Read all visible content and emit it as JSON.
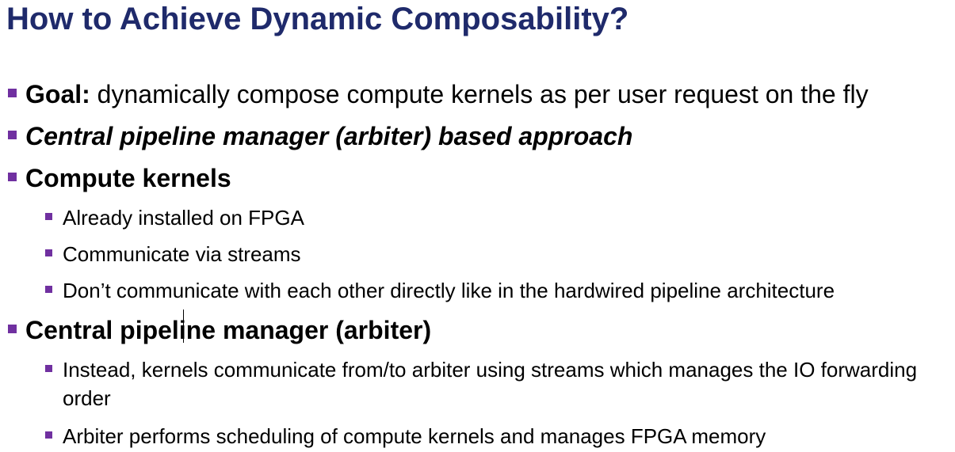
{
  "slide": {
    "title": "How to Achieve Dynamic Composability?",
    "bullets": [
      {
        "lead": "Goal:",
        "rest": " dynamically compose compute kernels as per user request on the fly"
      },
      {
        "text": "Central pipeline manager (arbiter) based approach"
      },
      {
        "text": "Compute kernels"
      },
      {
        "text": "Already installed on FPGA"
      },
      {
        "text": "Communicate via streams"
      },
      {
        "text": "Don’t communicate with each other directly like in the hardwired pipeline architecture"
      },
      {
        "text": "Central pipeline manager (arbiter)"
      },
      {
        "text": "Instead, kernels communicate from/to arbiter using streams which manages the IO forwarding order"
      },
      {
        "text": "Arbiter performs scheduling of compute kernels and manages FPGA memory"
      }
    ]
  },
  "colors": {
    "title": "#1f2a6b",
    "bullet": "#7030a0",
    "text": "#000000"
  }
}
